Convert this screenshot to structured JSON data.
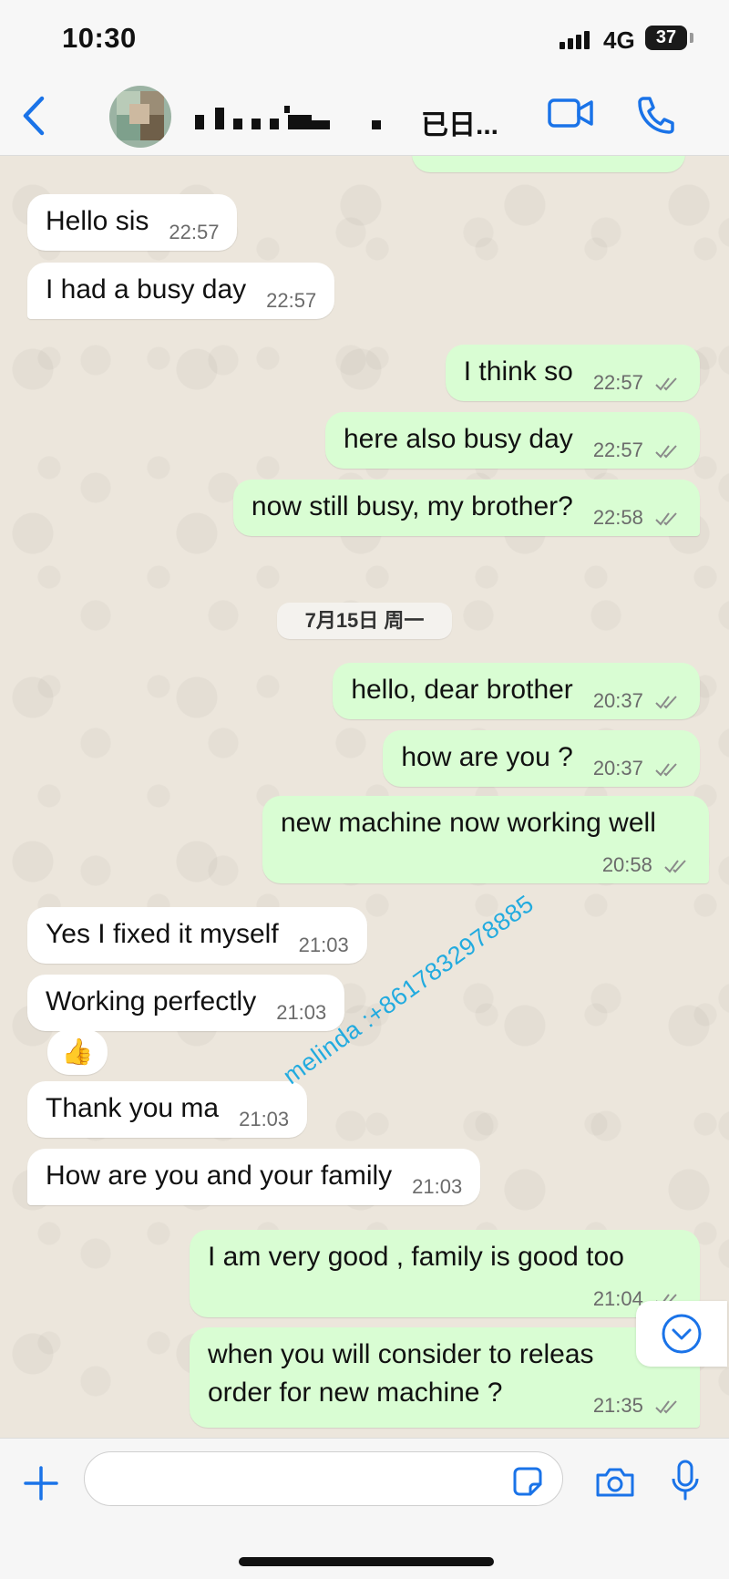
{
  "status_bar": {
    "time": "10:30",
    "network": "4G",
    "battery": "37"
  },
  "header": {
    "contact_name_visible": "已日..."
  },
  "date_divider": "7月15日 周一",
  "messages": [
    {
      "dir": "in",
      "text": "Hello sis",
      "time": "22:57"
    },
    {
      "dir": "in",
      "text": "I had a busy day",
      "time": "22:57"
    },
    {
      "dir": "out",
      "text": "I think so",
      "time": "22:57"
    },
    {
      "dir": "out",
      "text": "here also busy day",
      "time": "22:57"
    },
    {
      "dir": "out",
      "text": "now still busy, my brother?",
      "time": "22:58"
    },
    {
      "dir": "out",
      "text": "hello, dear brother",
      "time": "20:37"
    },
    {
      "dir": "out",
      "text": "how are you ?",
      "time": "20:37"
    },
    {
      "dir": "out",
      "text": "new machine now working well",
      "time": "20:58"
    },
    {
      "dir": "in",
      "text": "Yes I fixed it myself",
      "time": "21:03"
    },
    {
      "dir": "in",
      "text": "Working perfectly",
      "time": "21:03"
    },
    {
      "dir": "in",
      "text": "Thank you ma",
      "time": "21:03"
    },
    {
      "dir": "in",
      "text": "How are you and your family",
      "time": "21:03"
    },
    {
      "dir": "out",
      "text": "I am very good , family is good too",
      "time": "21:04"
    },
    {
      "dir": "out",
      "text_line1": "when you will consider to releas",
      "text_line2": "order for new machine ?",
      "time": "21:35"
    }
  ],
  "reaction_emoji": "👍",
  "watermark": "melinda :+8617832978885",
  "input": {
    "placeholder": ""
  },
  "colors": {
    "accent": "#1a73e8",
    "outgoing_bubble": "#d9fdd3",
    "incoming_bubble": "#ffffff",
    "watermark": "#18a8e0"
  }
}
